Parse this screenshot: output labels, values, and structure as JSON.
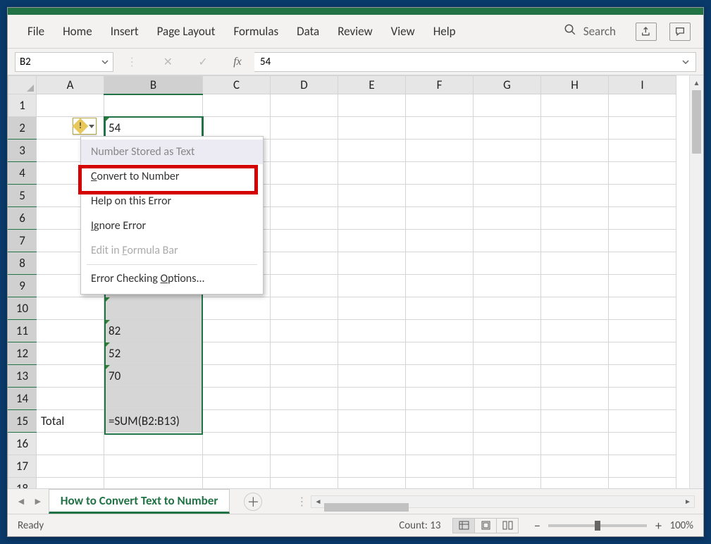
{
  "ribbon": {
    "tabs": [
      "File",
      "Home",
      "Insert",
      "Page Layout",
      "Formulas",
      "Data",
      "Review",
      "View",
      "Help"
    ],
    "search_label": "Search"
  },
  "name_box": {
    "value": "B2"
  },
  "formula_bar": {
    "fx": "fx",
    "value": "54",
    "cancel": "✕",
    "enter": "✓"
  },
  "columns": [
    "A",
    "B",
    "C",
    "D",
    "E",
    "F",
    "G",
    "H",
    "I"
  ],
  "row_count": 18,
  "cells": {
    "B2": "54",
    "B11": "82",
    "B12": "52",
    "B13": "70",
    "A15": "Total",
    "B15": "=SUM(B2:B13)"
  },
  "selected_range": {
    "from": "B2",
    "to": "B15",
    "active": "B2"
  },
  "smart_tag_menu": {
    "header": "Number Stored as Text",
    "items": [
      {
        "label_html": "<u>C</u>onvert to Number",
        "highlighted": true
      },
      {
        "label_html": "Help on this Error"
      },
      {
        "label_html": "<u>I</u>gnore Error"
      },
      {
        "label_html": "Edit in <u>F</u>ormula Bar",
        "disabled": true
      },
      {
        "sep": true
      },
      {
        "label_html": "Error Checking <u>O</u>ptions..."
      }
    ]
  },
  "sheet": {
    "name": "How to Convert Text to Number"
  },
  "status": {
    "ready": "Ready",
    "count_label": "Count:",
    "count_value": "13",
    "zoom": "100%"
  }
}
